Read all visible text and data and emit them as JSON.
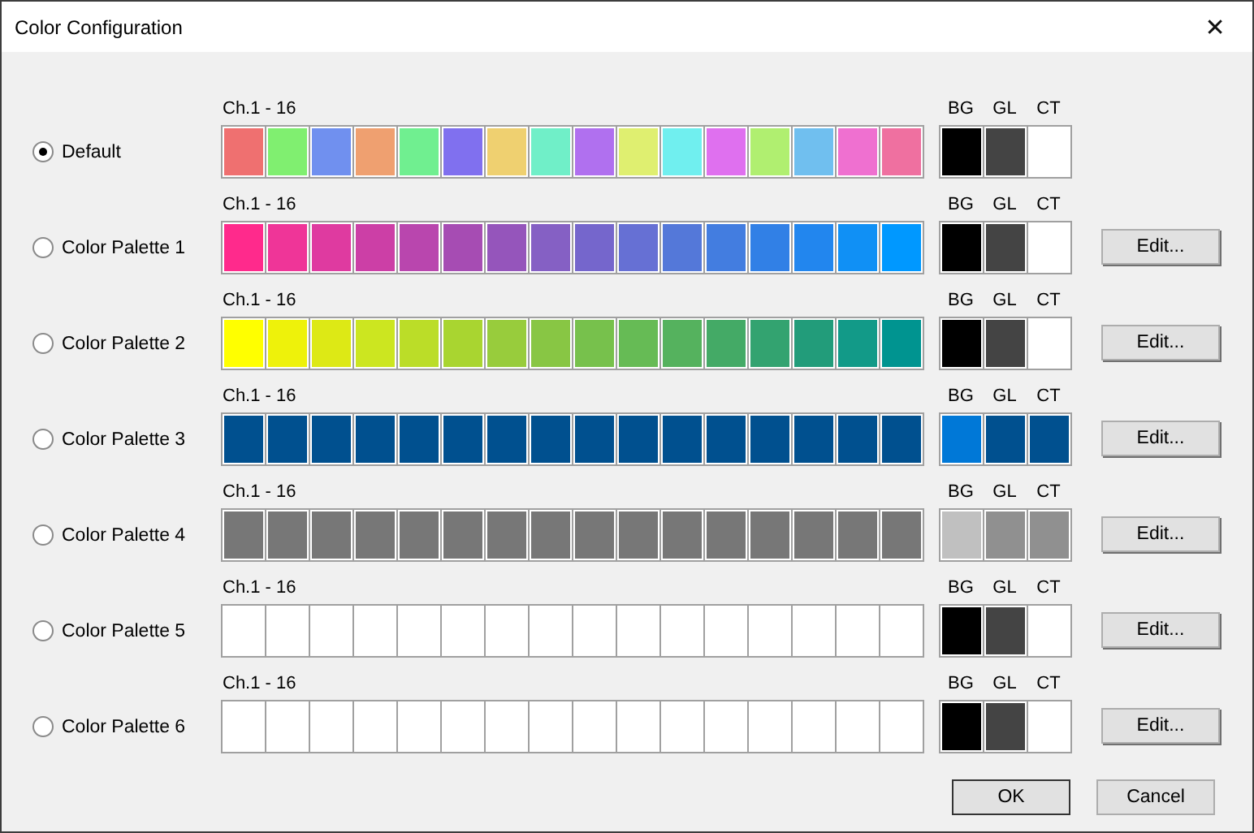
{
  "window": {
    "title": "Color Configuration",
    "close": "✕"
  },
  "palettes": [
    {
      "name": "Default",
      "selected": true,
      "channel_label": "Ch.1 - 16",
      "extra_labels": [
        "BG",
        "GL",
        "CT"
      ],
      "channels": [
        {
          "color": "#ef7070"
        },
        {
          "color": "#80ef70"
        },
        {
          "color": "#7090ef"
        },
        {
          "color": "#efa070"
        },
        {
          "color": "#70ef90"
        },
        {
          "color": "#8070ef"
        },
        {
          "color": "#efd070"
        },
        {
          "color": "#70efc8"
        },
        {
          "color": "#b070ef"
        },
        {
          "color": "#dfef70"
        },
        {
          "color": "#70efef"
        },
        {
          "color": "#df70ef"
        },
        {
          "color": "#b0ef70"
        },
        {
          "color": "#70bfef"
        },
        {
          "color": "#ef70d0"
        },
        {
          "color": "#ef70a0"
        }
      ],
      "extras": [
        {
          "color": "#000000"
        },
        {
          "color": "#444444"
        },
        {
          "color": "#ffffff"
        }
      ]
    },
    {
      "name": "Color Palette 1",
      "selected": false,
      "channel_label": "Ch.1 - 16",
      "extra_labels": [
        "BG",
        "GL",
        "CT"
      ],
      "channels": [
        {
          "color": "#ff2a8c"
        },
        {
          "color": "#ef3598"
        },
        {
          "color": "#df3aa0"
        },
        {
          "color": "#cc3fa6"
        },
        {
          "color": "#b946ae"
        },
        {
          "color": "#a64cb3"
        },
        {
          "color": "#9555bb"
        },
        {
          "color": "#8560c4"
        },
        {
          "color": "#7566cc"
        },
        {
          "color": "#6670d4"
        },
        {
          "color": "#5478d9"
        },
        {
          "color": "#437de0"
        },
        {
          "color": "#3180e6"
        },
        {
          "color": "#2286ee"
        },
        {
          "color": "#1090f5"
        },
        {
          "color": "#0098ff"
        }
      ],
      "extras": [
        {
          "color": "#000000"
        },
        {
          "color": "#444444"
        },
        {
          "color": "#ffffff"
        }
      ],
      "edit_button": "Edit..."
    },
    {
      "name": "Color Palette 2",
      "selected": false,
      "channel_label": "Ch.1 - 16",
      "extra_labels": [
        "BG",
        "GL",
        "CT"
      ],
      "channels": [
        {
          "color": "#ffff00"
        },
        {
          "color": "#eef20a"
        },
        {
          "color": "#dde915"
        },
        {
          "color": "#cce620"
        },
        {
          "color": "#bbdd28"
        },
        {
          "color": "#a9d530"
        },
        {
          "color": "#98cc3c"
        },
        {
          "color": "#88c644"
        },
        {
          "color": "#77c14c"
        },
        {
          "color": "#66bb55"
        },
        {
          "color": "#55b25e"
        },
        {
          "color": "#44aa66"
        },
        {
          "color": "#33a370"
        },
        {
          "color": "#229c7a"
        },
        {
          "color": "#129a88"
        },
        {
          "color": "#009490"
        }
      ],
      "extras": [
        {
          "color": "#000000"
        },
        {
          "color": "#444444"
        },
        {
          "color": "#ffffff"
        }
      ],
      "edit_button": "Edit..."
    },
    {
      "name": "Color Palette 3",
      "selected": false,
      "channel_label": "Ch.1 - 16",
      "extra_labels": [
        "BG",
        "GL",
        "CT"
      ],
      "channels": [
        {
          "color": "#00508f"
        },
        {
          "color": "#00508f"
        },
        {
          "color": "#00508f"
        },
        {
          "color": "#00508f"
        },
        {
          "color": "#00508f"
        },
        {
          "color": "#00508f"
        },
        {
          "color": "#00508f"
        },
        {
          "color": "#00508f"
        },
        {
          "color": "#00508f"
        },
        {
          "color": "#00508f"
        },
        {
          "color": "#00508f"
        },
        {
          "color": "#00508f"
        },
        {
          "color": "#00508f"
        },
        {
          "color": "#00508f"
        },
        {
          "color": "#00508f"
        },
        {
          "color": "#00508f"
        }
      ],
      "extras": [
        {
          "color": "#0078d7"
        },
        {
          "color": "#00508f"
        },
        {
          "color": "#00508f"
        }
      ],
      "edit_button": "Edit..."
    },
    {
      "name": "Color Palette 4",
      "selected": false,
      "channel_label": "Ch.1 - 16",
      "extra_labels": [
        "BG",
        "GL",
        "CT"
      ],
      "channels": [
        {
          "color": "#777777"
        },
        {
          "color": "#777777"
        },
        {
          "color": "#777777"
        },
        {
          "color": "#777777"
        },
        {
          "color": "#777777"
        },
        {
          "color": "#777777"
        },
        {
          "color": "#777777"
        },
        {
          "color": "#777777"
        },
        {
          "color": "#777777"
        },
        {
          "color": "#777777"
        },
        {
          "color": "#777777"
        },
        {
          "color": "#777777"
        },
        {
          "color": "#777777"
        },
        {
          "color": "#777777"
        },
        {
          "color": "#777777"
        },
        {
          "color": "#777777"
        }
      ],
      "extras": [
        {
          "color": "#c0c0c0"
        },
        {
          "color": "#909090"
        },
        {
          "color": "#909090"
        }
      ],
      "edit_button": "Edit..."
    },
    {
      "name": "Color Palette 5",
      "selected": false,
      "channel_label": "Ch.1 - 16",
      "extra_labels": [
        "BG",
        "GL",
        "CT"
      ],
      "channels": [
        {
          "color": "#ffffff"
        },
        {
          "color": "#ffffff"
        },
        {
          "color": "#ffffff"
        },
        {
          "color": "#ffffff"
        },
        {
          "color": "#ffffff"
        },
        {
          "color": "#ffffff"
        },
        {
          "color": "#ffffff"
        },
        {
          "color": "#ffffff"
        },
        {
          "color": "#ffffff"
        },
        {
          "color": "#ffffff"
        },
        {
          "color": "#ffffff"
        },
        {
          "color": "#ffffff"
        },
        {
          "color": "#ffffff"
        },
        {
          "color": "#ffffff"
        },
        {
          "color": "#ffffff"
        },
        {
          "color": "#ffffff"
        }
      ],
      "extras": [
        {
          "color": "#000000"
        },
        {
          "color": "#444444"
        },
        {
          "color": "#ffffff"
        }
      ],
      "edit_button": "Edit..."
    },
    {
      "name": "Color Palette 6",
      "selected": false,
      "channel_label": "Ch.1 - 16",
      "extra_labels": [
        "BG",
        "GL",
        "CT"
      ],
      "channels": [
        {
          "color": "#ffffff"
        },
        {
          "color": "#ffffff"
        },
        {
          "color": "#ffffff"
        },
        {
          "color": "#ffffff"
        },
        {
          "color": "#ffffff"
        },
        {
          "color": "#ffffff"
        },
        {
          "color": "#ffffff"
        },
        {
          "color": "#ffffff"
        },
        {
          "color": "#ffffff"
        },
        {
          "color": "#ffffff"
        },
        {
          "color": "#ffffff"
        },
        {
          "color": "#ffffff"
        },
        {
          "color": "#ffffff"
        },
        {
          "color": "#ffffff"
        },
        {
          "color": "#ffffff"
        },
        {
          "color": "#ffffff"
        }
      ],
      "extras": [
        {
          "color": "#000000"
        },
        {
          "color": "#444444"
        },
        {
          "color": "#ffffff"
        }
      ],
      "edit_button": "Edit..."
    }
  ],
  "buttons": [
    "OK",
    "Cancel"
  ]
}
